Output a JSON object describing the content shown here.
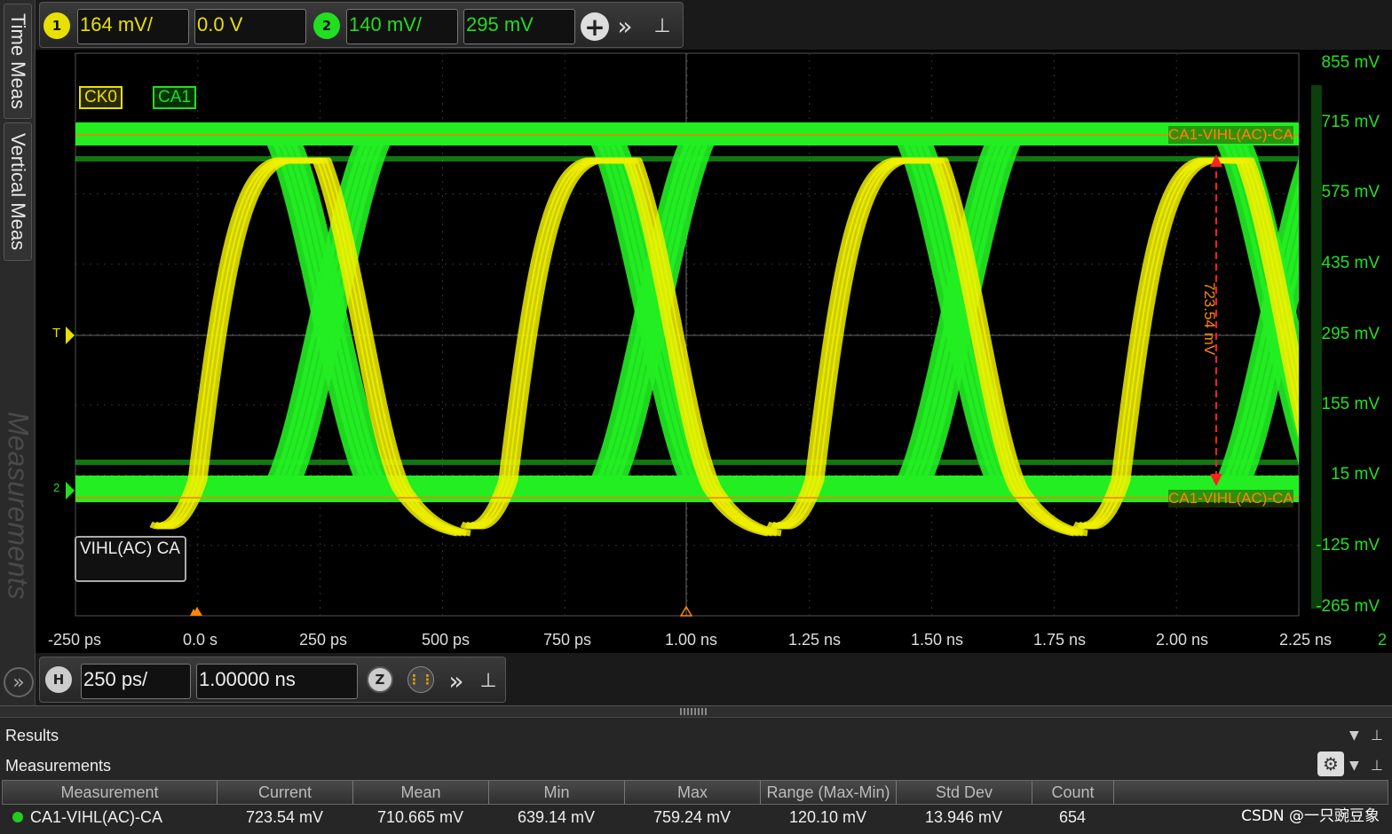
{
  "side_tabs": [
    "Time Meas",
    "Vertical Meas",
    "Measurements"
  ],
  "channel_toolbar": {
    "ch1": {
      "badge": "1",
      "scale": "164 mV/",
      "offset": "0.0 V",
      "color": "#e8e000"
    },
    "ch2": {
      "badge": "2",
      "scale": "140 mV/",
      "offset": "295 mV",
      "color": "#22dd22"
    }
  },
  "plot": {
    "channel_tags": [
      "CK0",
      "CA1"
    ],
    "y_labels": [
      "855 mV",
      "715 mV",
      "575 mV",
      "435 mV",
      "295 mV",
      "155 mV",
      "15 mV",
      "-125 mV",
      "-265 mV"
    ],
    "x_labels": [
      "-250 ps",
      "0.0 s",
      "250 ps",
      "500 ps",
      "750 ps",
      "1.00 ns",
      "1.25 ns",
      "1.50 ns",
      "1.75 ns",
      "2.00 ns",
      "2.25 ns",
      "2"
    ],
    "cursor_label": "CA1-VIHL(AC)-CA",
    "delta_label": "723.54 mV",
    "box_label": "VIHL(AC) CA",
    "trigger_marker": "T",
    "ground_marker": "2"
  },
  "h_toolbar": {
    "badge": "H",
    "scale": "250 ps/",
    "position": "1.00000 ns",
    "zoom_badge": "Z"
  },
  "results": {
    "title": "Results",
    "subtitle": "Measurements",
    "columns": [
      "Measurement",
      "Current",
      "Mean",
      "Min",
      "Max",
      "Range (Max-Min)",
      "Std Dev",
      "Count"
    ],
    "row": {
      "measurement": "CA1-VIHL(AC)-CA",
      "current": "723.54 mV",
      "mean": "710.665 mV",
      "min": "639.14 mV",
      "max": "759.24 mV",
      "range": "120.10 mV",
      "std_dev": "13.946 mV",
      "count": "654"
    }
  },
  "watermark": "CSDN @一只豌豆象",
  "icons": {
    "add": "plus-circle-icon",
    "more": "double-chevron-right-icon",
    "pin": "pin-icon",
    "gear": "gear-icon",
    "expand": "double-chevron-right-icon"
  }
}
